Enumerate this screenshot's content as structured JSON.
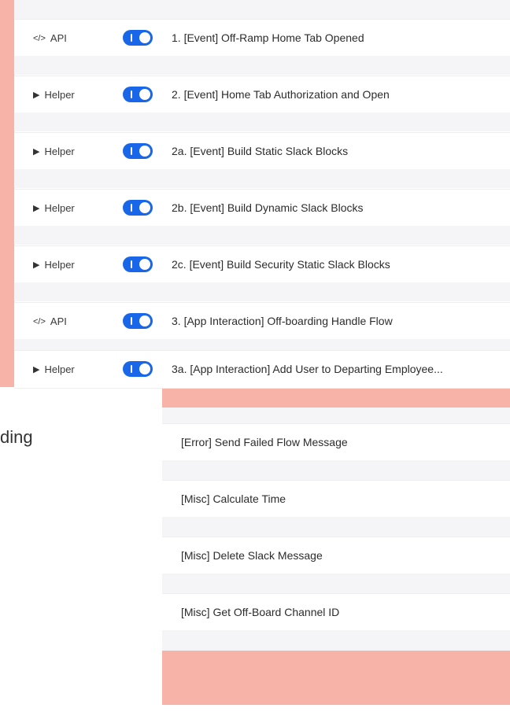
{
  "top_flows": [
    {
      "tag_icon": "</>",
      "tag": "API",
      "enabled": true,
      "name": "1. [Event] Off-Ramp Home Tab Opened"
    },
    {
      "tag_icon": "▶",
      "tag": "Helper",
      "enabled": true,
      "name": "2. [Event] Home Tab Authorization and Open"
    },
    {
      "tag_icon": "▶",
      "tag": "Helper",
      "enabled": true,
      "name": "2a. [Event] Build Static Slack Blocks"
    },
    {
      "tag_icon": "▶",
      "tag": "Helper",
      "enabled": true,
      "name": "2b. [Event] Build Dynamic Slack Blocks"
    },
    {
      "tag_icon": "▶",
      "tag": "Helper",
      "enabled": true,
      "name": "2c. [Event] Build Security Static Slack Blocks"
    },
    {
      "tag_icon": "</>",
      "tag": "API",
      "enabled": true,
      "name": "3. [App Interaction] Off-boarding Handle Flow"
    },
    {
      "tag_icon": "▶",
      "tag": "Helper",
      "enabled": true,
      "name": "3a. [App Interaction] Add User to Departing Employee..."
    }
  ],
  "partial_heading": "ding",
  "bottom_flows": [
    {
      "name": "[Error] Send Failed Flow Message"
    },
    {
      "name": "[Misc] Calculate Time"
    },
    {
      "name": "[Misc] Delete Slack Message"
    },
    {
      "name": "[Misc] Get Off-Board Channel ID"
    }
  ],
  "colors": {
    "accent": "#1a66e8",
    "background_pink": "#f7b3a7"
  }
}
